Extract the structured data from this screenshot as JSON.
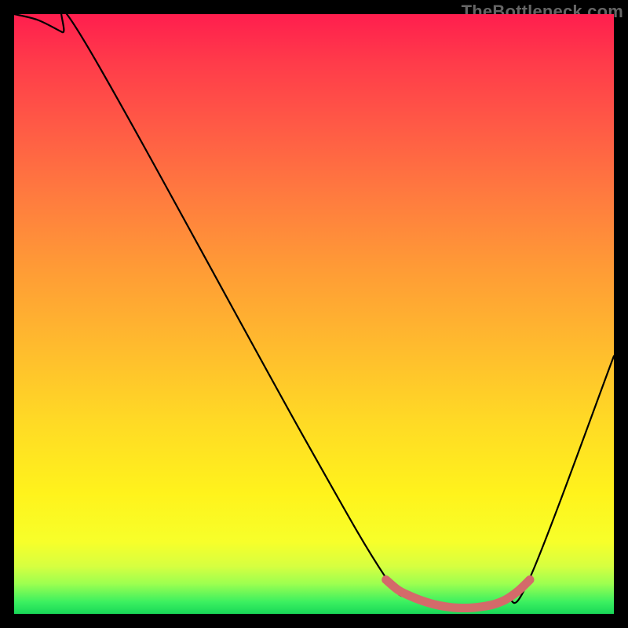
{
  "attribution": "TheBottleneck.com",
  "chart_data": {
    "type": "line",
    "title": "",
    "xlabel": "",
    "ylabel": "",
    "xlim": [
      0,
      100
    ],
    "ylim": [
      0,
      100
    ],
    "annotations": [
      "TheBottleneck.com"
    ],
    "series": [
      {
        "name": "bottleneck-curve",
        "x": [
          0,
          4,
          8,
          12,
          48,
          62,
          66,
          70,
          74,
          78,
          82,
          86,
          100
        ],
        "values": [
          100,
          99,
          97,
          95,
          30,
          6,
          3,
          1.5,
          1,
          1.2,
          2.5,
          6,
          43
        ],
        "color": "#000000"
      },
      {
        "name": "optimal-range-marker",
        "x": [
          62,
          64,
          66,
          68,
          70,
          72,
          74,
          76,
          78,
          80,
          82,
          84,
          86
        ],
        "values": [
          5.7,
          4.0,
          3.0,
          2.2,
          1.6,
          1.2,
          1.0,
          1.0,
          1.2,
          1.6,
          2.4,
          3.8,
          5.7
        ],
        "color": "#d46a6a"
      }
    ]
  }
}
